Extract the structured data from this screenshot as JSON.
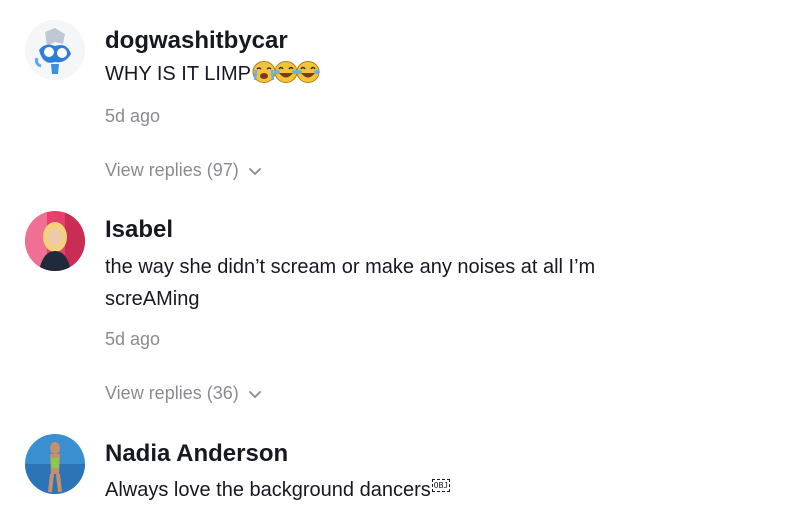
{
  "comments": [
    {
      "username": "dogwashitbycar",
      "text": "WHY IS IT LIMP",
      "emoji": [
        "loudly-crying-face",
        "face-with-tears-of-joy",
        "face-with-tears-of-joy"
      ],
      "time": "5d ago",
      "replies": "View replies (97)"
    },
    {
      "username": "Isabel",
      "text_line1": "the way she didn’t scream or make any noises at all I’m",
      "text_line2": "screAMing",
      "time": "5d ago",
      "replies": "View replies (36)"
    },
    {
      "username": "Nadia Anderson",
      "text": "Always love the background dancers",
      "object_glyph": "OBJ"
    }
  ],
  "colors": {
    "primary_text": "#161823",
    "secondary_text": "#8a8b91"
  }
}
